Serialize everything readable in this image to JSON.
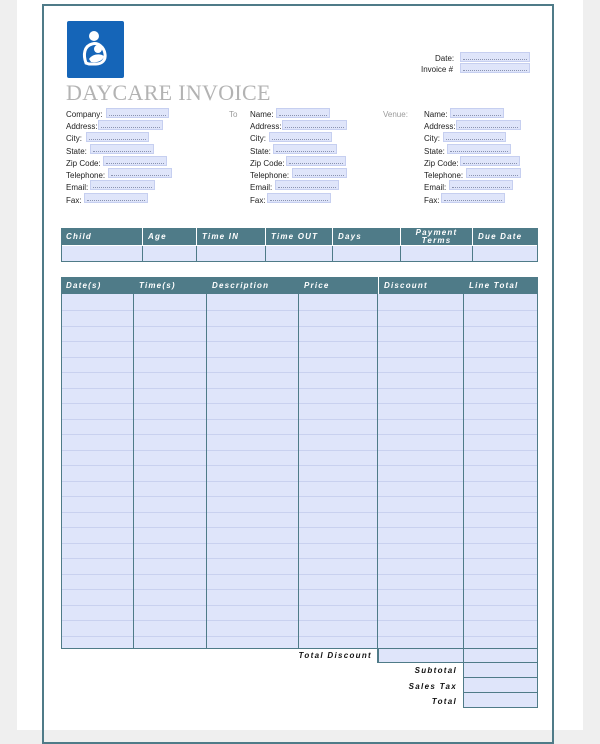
{
  "title": "DAYCARE INVOICE",
  "logo_icon": "mother-and-child-icon",
  "meta": {
    "date_label": "Date:",
    "invoice_label": "Invoice #"
  },
  "from": {
    "labels": [
      "Company:",
      "Address:",
      "City:",
      "State:",
      "Zip Code:",
      "Telephone:",
      "Email:",
      "Fax:"
    ]
  },
  "to": {
    "heading": "To",
    "labels": [
      "Name:",
      "Address:",
      "City:",
      "State:",
      "Zip Code:",
      "Telephone:",
      "Email:",
      "Fax:"
    ]
  },
  "venue": {
    "heading": "Venue:",
    "labels": [
      "Name:",
      "Address:",
      "City:",
      "State:",
      "Zip Code:",
      "Telephone:",
      "Email:",
      "Fax:"
    ]
  },
  "child_table": {
    "headers": [
      "Child",
      "Age",
      "Time IN",
      "Time OUT",
      "Days",
      "Payment Terms",
      "Due Date"
    ]
  },
  "items_table": {
    "headers": [
      "Date(s)",
      "Time(s)",
      "Description",
      "Price",
      "Discount",
      "Line Total"
    ]
  },
  "summary": {
    "total_discount": "Total Discount",
    "subtotal": "Subtotal",
    "sales_tax": "Sales Tax",
    "total": "Total"
  },
  "colors": {
    "header": "#4f7b88",
    "field": "#dfe5fa",
    "logo": "#1565b8",
    "title": "#b3b3b3"
  }
}
